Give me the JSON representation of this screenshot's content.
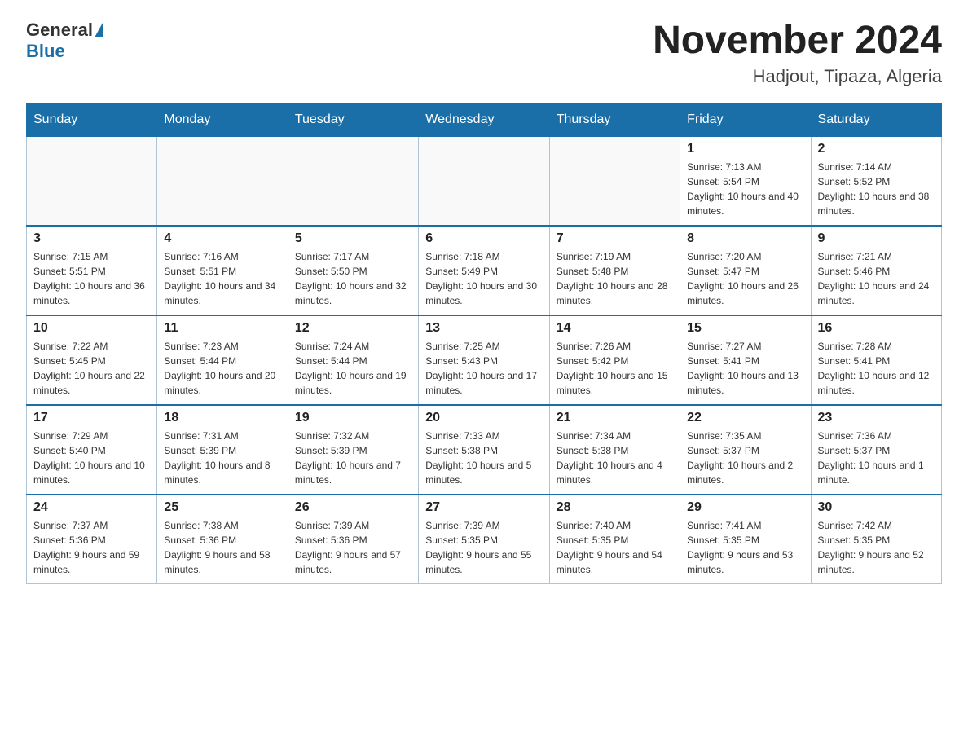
{
  "logo": {
    "general": "General",
    "blue": "Blue"
  },
  "header": {
    "month_year": "November 2024",
    "location": "Hadjout, Tipaza, Algeria"
  },
  "days_of_week": [
    "Sunday",
    "Monday",
    "Tuesday",
    "Wednesday",
    "Thursday",
    "Friday",
    "Saturday"
  ],
  "weeks": [
    [
      {
        "day": "",
        "sunrise": "",
        "sunset": "",
        "daylight": ""
      },
      {
        "day": "",
        "sunrise": "",
        "sunset": "",
        "daylight": ""
      },
      {
        "day": "",
        "sunrise": "",
        "sunset": "",
        "daylight": ""
      },
      {
        "day": "",
        "sunrise": "",
        "sunset": "",
        "daylight": ""
      },
      {
        "day": "",
        "sunrise": "",
        "sunset": "",
        "daylight": ""
      },
      {
        "day": "1",
        "sunrise": "Sunrise: 7:13 AM",
        "sunset": "Sunset: 5:54 PM",
        "daylight": "Daylight: 10 hours and 40 minutes."
      },
      {
        "day": "2",
        "sunrise": "Sunrise: 7:14 AM",
        "sunset": "Sunset: 5:52 PM",
        "daylight": "Daylight: 10 hours and 38 minutes."
      }
    ],
    [
      {
        "day": "3",
        "sunrise": "Sunrise: 7:15 AM",
        "sunset": "Sunset: 5:51 PM",
        "daylight": "Daylight: 10 hours and 36 minutes."
      },
      {
        "day": "4",
        "sunrise": "Sunrise: 7:16 AM",
        "sunset": "Sunset: 5:51 PM",
        "daylight": "Daylight: 10 hours and 34 minutes."
      },
      {
        "day": "5",
        "sunrise": "Sunrise: 7:17 AM",
        "sunset": "Sunset: 5:50 PM",
        "daylight": "Daylight: 10 hours and 32 minutes."
      },
      {
        "day": "6",
        "sunrise": "Sunrise: 7:18 AM",
        "sunset": "Sunset: 5:49 PM",
        "daylight": "Daylight: 10 hours and 30 minutes."
      },
      {
        "day": "7",
        "sunrise": "Sunrise: 7:19 AM",
        "sunset": "Sunset: 5:48 PM",
        "daylight": "Daylight: 10 hours and 28 minutes."
      },
      {
        "day": "8",
        "sunrise": "Sunrise: 7:20 AM",
        "sunset": "Sunset: 5:47 PM",
        "daylight": "Daylight: 10 hours and 26 minutes."
      },
      {
        "day": "9",
        "sunrise": "Sunrise: 7:21 AM",
        "sunset": "Sunset: 5:46 PM",
        "daylight": "Daylight: 10 hours and 24 minutes."
      }
    ],
    [
      {
        "day": "10",
        "sunrise": "Sunrise: 7:22 AM",
        "sunset": "Sunset: 5:45 PM",
        "daylight": "Daylight: 10 hours and 22 minutes."
      },
      {
        "day": "11",
        "sunrise": "Sunrise: 7:23 AM",
        "sunset": "Sunset: 5:44 PM",
        "daylight": "Daylight: 10 hours and 20 minutes."
      },
      {
        "day": "12",
        "sunrise": "Sunrise: 7:24 AM",
        "sunset": "Sunset: 5:44 PM",
        "daylight": "Daylight: 10 hours and 19 minutes."
      },
      {
        "day": "13",
        "sunrise": "Sunrise: 7:25 AM",
        "sunset": "Sunset: 5:43 PM",
        "daylight": "Daylight: 10 hours and 17 minutes."
      },
      {
        "day": "14",
        "sunrise": "Sunrise: 7:26 AM",
        "sunset": "Sunset: 5:42 PM",
        "daylight": "Daylight: 10 hours and 15 minutes."
      },
      {
        "day": "15",
        "sunrise": "Sunrise: 7:27 AM",
        "sunset": "Sunset: 5:41 PM",
        "daylight": "Daylight: 10 hours and 13 minutes."
      },
      {
        "day": "16",
        "sunrise": "Sunrise: 7:28 AM",
        "sunset": "Sunset: 5:41 PM",
        "daylight": "Daylight: 10 hours and 12 minutes."
      }
    ],
    [
      {
        "day": "17",
        "sunrise": "Sunrise: 7:29 AM",
        "sunset": "Sunset: 5:40 PM",
        "daylight": "Daylight: 10 hours and 10 minutes."
      },
      {
        "day": "18",
        "sunrise": "Sunrise: 7:31 AM",
        "sunset": "Sunset: 5:39 PM",
        "daylight": "Daylight: 10 hours and 8 minutes."
      },
      {
        "day": "19",
        "sunrise": "Sunrise: 7:32 AM",
        "sunset": "Sunset: 5:39 PM",
        "daylight": "Daylight: 10 hours and 7 minutes."
      },
      {
        "day": "20",
        "sunrise": "Sunrise: 7:33 AM",
        "sunset": "Sunset: 5:38 PM",
        "daylight": "Daylight: 10 hours and 5 minutes."
      },
      {
        "day": "21",
        "sunrise": "Sunrise: 7:34 AM",
        "sunset": "Sunset: 5:38 PM",
        "daylight": "Daylight: 10 hours and 4 minutes."
      },
      {
        "day": "22",
        "sunrise": "Sunrise: 7:35 AM",
        "sunset": "Sunset: 5:37 PM",
        "daylight": "Daylight: 10 hours and 2 minutes."
      },
      {
        "day": "23",
        "sunrise": "Sunrise: 7:36 AM",
        "sunset": "Sunset: 5:37 PM",
        "daylight": "Daylight: 10 hours and 1 minute."
      }
    ],
    [
      {
        "day": "24",
        "sunrise": "Sunrise: 7:37 AM",
        "sunset": "Sunset: 5:36 PM",
        "daylight": "Daylight: 9 hours and 59 minutes."
      },
      {
        "day": "25",
        "sunrise": "Sunrise: 7:38 AM",
        "sunset": "Sunset: 5:36 PM",
        "daylight": "Daylight: 9 hours and 58 minutes."
      },
      {
        "day": "26",
        "sunrise": "Sunrise: 7:39 AM",
        "sunset": "Sunset: 5:36 PM",
        "daylight": "Daylight: 9 hours and 57 minutes."
      },
      {
        "day": "27",
        "sunrise": "Sunrise: 7:39 AM",
        "sunset": "Sunset: 5:35 PM",
        "daylight": "Daylight: 9 hours and 55 minutes."
      },
      {
        "day": "28",
        "sunrise": "Sunrise: 7:40 AM",
        "sunset": "Sunset: 5:35 PM",
        "daylight": "Daylight: 9 hours and 54 minutes."
      },
      {
        "day": "29",
        "sunrise": "Sunrise: 7:41 AM",
        "sunset": "Sunset: 5:35 PM",
        "daylight": "Daylight: 9 hours and 53 minutes."
      },
      {
        "day": "30",
        "sunrise": "Sunrise: 7:42 AM",
        "sunset": "Sunset: 5:35 PM",
        "daylight": "Daylight: 9 hours and 52 minutes."
      }
    ]
  ]
}
